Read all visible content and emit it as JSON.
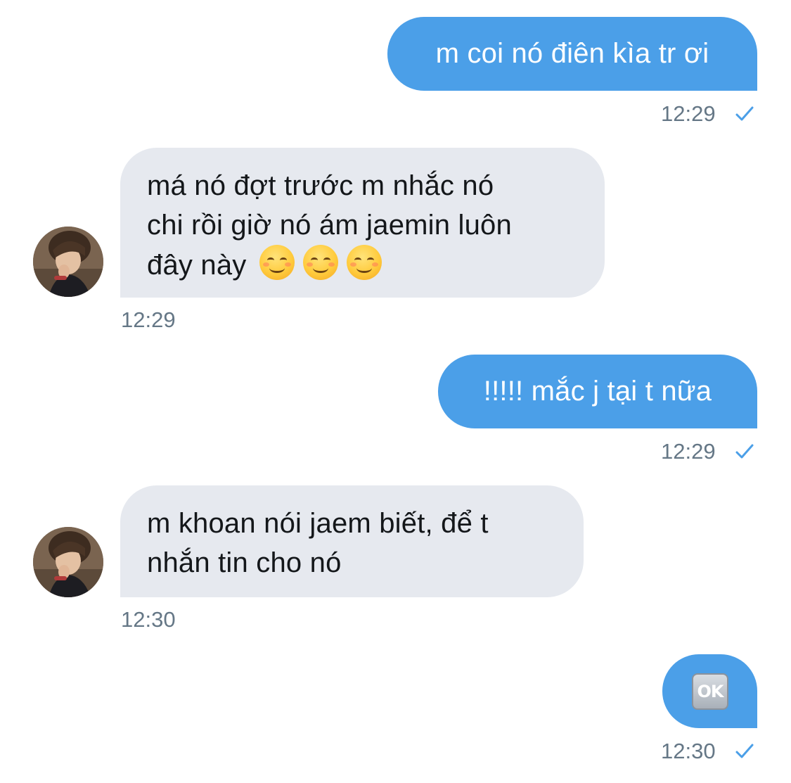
{
  "messages": [
    {
      "direction": "outgoing",
      "text": "m coi nó điên kìa tr ơi",
      "time": "12:29",
      "status_icon": "check-icon"
    },
    {
      "direction": "incoming",
      "lines": [
        "má nó đợt trước m nhắc nó",
        "chi rồi giờ nó ám jaemin luôn",
        "đây này"
      ],
      "emoji": [
        "smiling-face-icon",
        "smiling-face-icon",
        "smiling-face-icon"
      ],
      "time": "12:29"
    },
    {
      "direction": "outgoing",
      "text": "!!!!! mắc j tại t nữa",
      "time": "12:29",
      "status_icon": "check-icon"
    },
    {
      "direction": "incoming",
      "lines": [
        "m khoan nói jaem biết, để t",
        "nhắn tin cho nó"
      ],
      "time": "12:30"
    },
    {
      "direction": "outgoing",
      "emoji_text": "OK",
      "emoji": "ok-button-icon",
      "time": "12:30",
      "status_icon": "check-icon"
    }
  ],
  "colors": {
    "outgoing_bubble": "#4b9fe8",
    "incoming_bubble": "#e6e9ef",
    "timestamp": "#657786",
    "check": "#4b9fe8"
  }
}
